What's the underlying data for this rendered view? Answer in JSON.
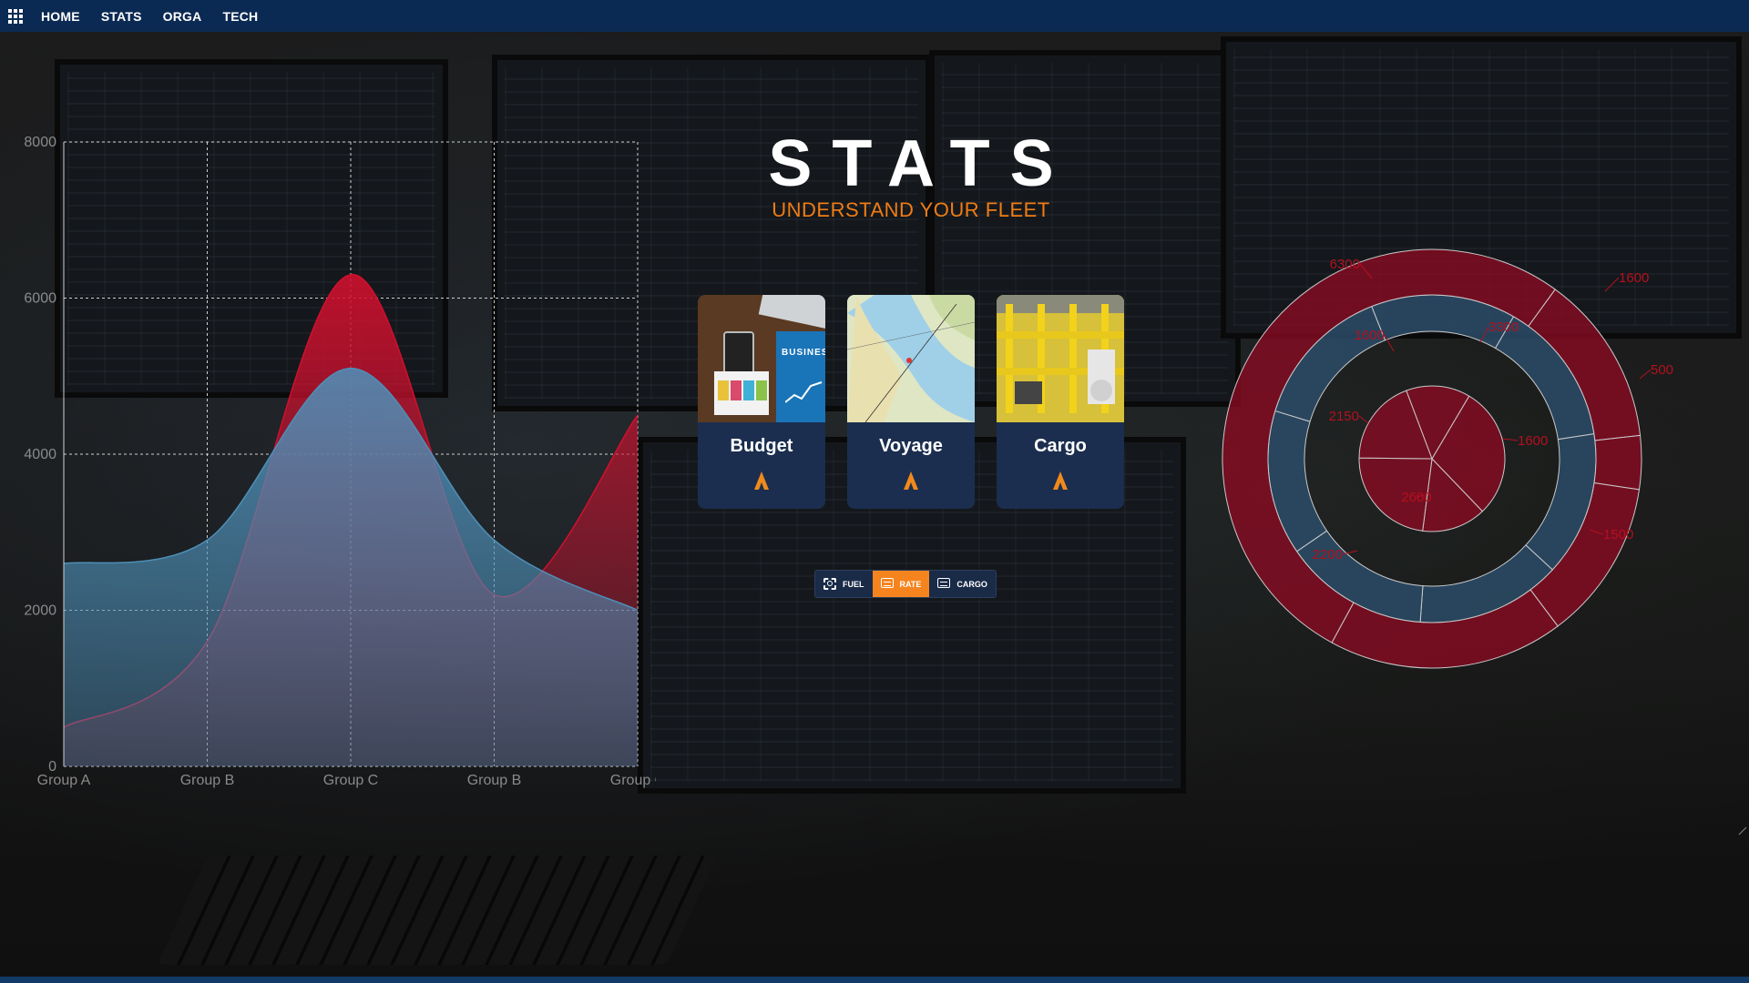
{
  "nav": {
    "items": [
      "HOME",
      "STATS",
      "ORGA",
      "TECH"
    ]
  },
  "header": {
    "title": "STATS",
    "subtitle": "UNDERSTAND YOUR FLEET"
  },
  "cards": [
    {
      "label": "Budget",
      "image": "budget-photo",
      "icon": "arrow-up-icon"
    },
    {
      "label": "Voyage",
      "image": "nautical-chart-photo",
      "icon": "arrow-up-icon"
    },
    {
      "label": "Cargo",
      "image": "port-cranes-photo",
      "icon": "arrow-up-icon"
    }
  ],
  "book_text": "BUSINESS",
  "segmented": {
    "options": [
      {
        "label": "FUEL",
        "icon": "scan-icon",
        "active": false
      },
      {
        "label": "RATE",
        "icon": "message-icon",
        "active": true
      },
      {
        "label": "CARGO",
        "icon": "message-icon",
        "active": false
      }
    ]
  },
  "colors": {
    "navbar": "#0b2a53",
    "accent": "#f07c16",
    "card": "#1b2e4f",
    "series_red": "#d0102e",
    "series_blue": "#4f8fb8",
    "donut_red": "#8c0a22",
    "donut_blue": "#2b4c68"
  },
  "chart_data": [
    {
      "type": "area",
      "categories": [
        "Group A",
        "Group B",
        "Group C",
        "Group B",
        "Group C"
      ],
      "ylim": [
        0,
        8000
      ],
      "yticks": [
        0,
        2000,
        4000,
        6000,
        8000
      ],
      "grid": true,
      "series": [
        {
          "color": "#4f8fb8",
          "values": [
            2600,
            2900,
            5100,
            2900,
            2000
          ]
        },
        {
          "color": "#d0102e",
          "values": [
            500,
            1600,
            6300,
            2200,
            4500
          ]
        }
      ]
    },
    {
      "type": "pie",
      "rings": [
        {
          "ring": "inner",
          "values": [
            3300,
            1600,
            2600,
            2150,
            1600
          ]
        },
        {
          "ring": "middle",
          "values": [
            1,
            1,
            1,
            1,
            1,
            1,
            1
          ]
        },
        {
          "ring": "outer",
          "values": [
            1600,
            500,
            1500,
            2200,
            6300
          ]
        }
      ],
      "labels": [
        {
          "text": "6300"
        },
        {
          "text": "1600"
        },
        {
          "text": "500"
        },
        {
          "text": "1500"
        },
        {
          "text": "2200"
        },
        {
          "text": "3300"
        },
        {
          "text": "1600"
        },
        {
          "text": "2150"
        },
        {
          "text": "2600"
        },
        {
          "text": "1600"
        }
      ]
    }
  ]
}
